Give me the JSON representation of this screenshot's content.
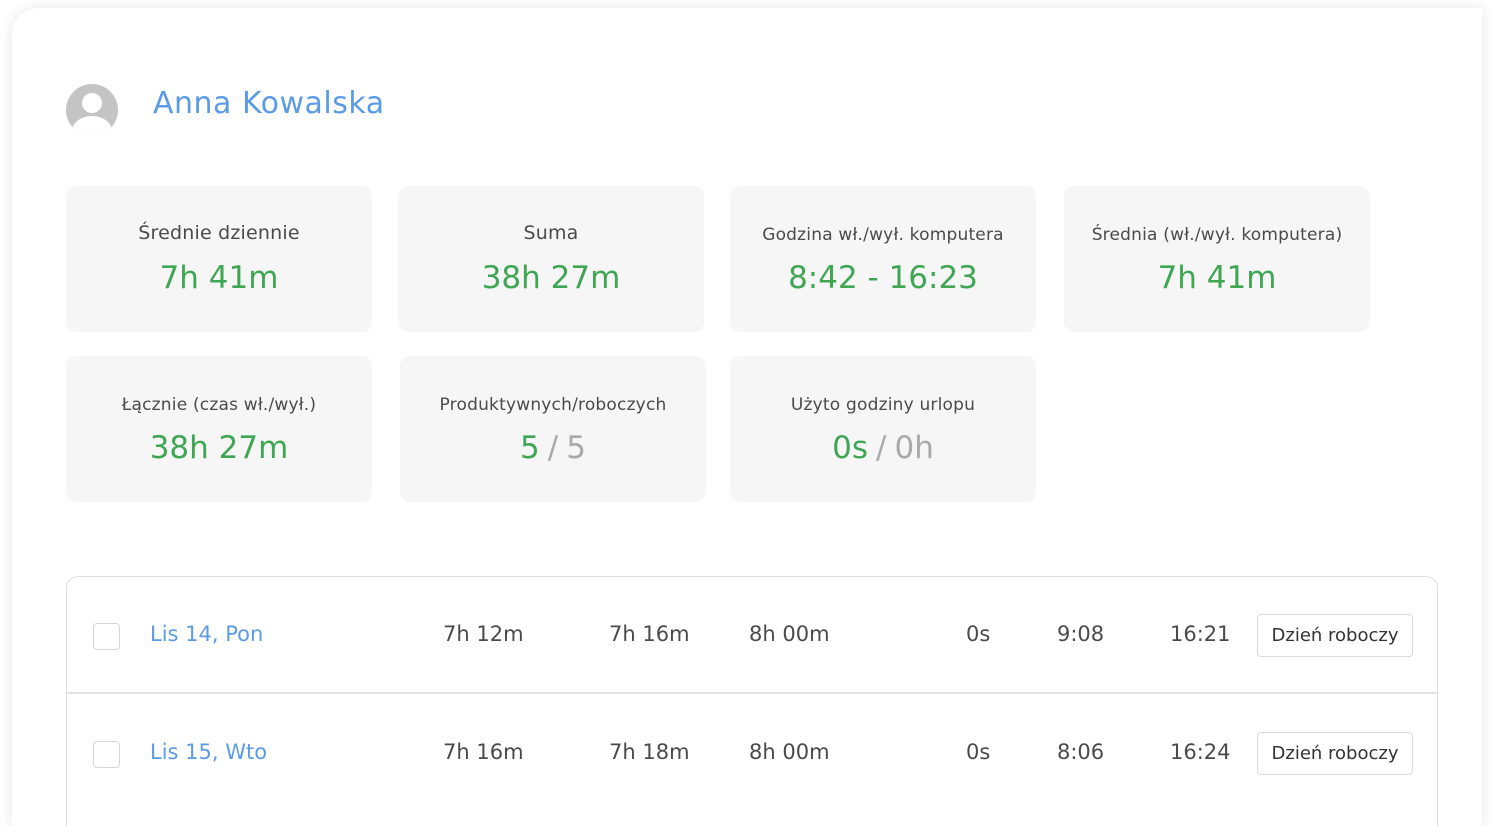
{
  "user": {
    "name": "Anna Kowalska"
  },
  "stats": [
    {
      "label": "Średnie dziennie",
      "value": "7h 41m"
    },
    {
      "label": "Suma",
      "value": "38h 27m"
    },
    {
      "label": "Godzina wł./wył. komputera",
      "value": "8:42 - 16:23"
    },
    {
      "label": "Średnia (wł./wył. komputera)",
      "value": "7h 41m"
    },
    {
      "label": "Łącznie (czas wł./wył.)",
      "value": "38h 27m"
    },
    {
      "label": "Produktywnych/roboczych",
      "value_primary": "5",
      "separator": "/",
      "value_secondary": "5"
    },
    {
      "label": "Użyto godziny urlopu",
      "value_primary": "0s",
      "separator": "/",
      "value_secondary": "0h"
    }
  ],
  "rows": [
    {
      "date": "Lis 14, Pon",
      "c1": "7h 12m",
      "c2": "7h 16m",
      "c3": "8h 00m",
      "c4": "0s",
      "start": "9:08",
      "end": "16:21",
      "day_type": "Dzień roboczy"
    },
    {
      "date": "Lis 15, Wto",
      "c1": "7h 16m",
      "c2": "7h 18m",
      "c3": "8h 00m",
      "c4": "0s",
      "start": "8:06",
      "end": "16:24",
      "day_type": "Dzień roboczy"
    }
  ],
  "colors": {
    "accent_blue": "#5b9be6",
    "value_green": "#3fa653",
    "muted_grey": "#a9a9a9",
    "tile_bg": "#f6f6f6"
  },
  "icons": {
    "avatar": "user-avatar-placeholder-icon"
  }
}
